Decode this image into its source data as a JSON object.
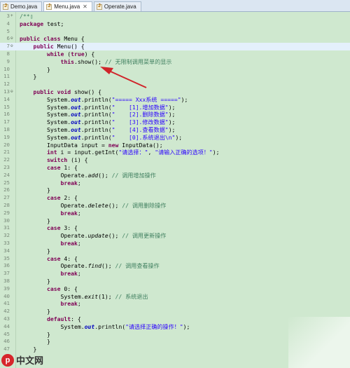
{
  "tabs": [
    {
      "label": "Demo.java",
      "active": false
    },
    {
      "label": "Menu.java",
      "active": true,
      "close": "✕"
    },
    {
      "label": "Operate.java",
      "active": false
    }
  ],
  "watermark": {
    "text": "中文网",
    "logo_char": "p"
  },
  "code_lines": [
    {
      "num": "3",
      "fold": "+",
      "segs": [
        {
          "t": "/**",
          "c": "cmt"
        },
        {
          "t": "▯",
          "c": "cmt"
        }
      ]
    },
    {
      "num": "4",
      "segs": [
        {
          "t": "package",
          "c": "kw"
        },
        {
          "t": " test;",
          "c": ""
        }
      ]
    },
    {
      "num": "5",
      "segs": []
    },
    {
      "num": "6",
      "fold": "⊖",
      "segs": [
        {
          "t": "public",
          "c": "kw"
        },
        {
          "t": " ",
          "c": ""
        },
        {
          "t": "class",
          "c": "kw"
        },
        {
          "t": " Menu {",
          "c": ""
        }
      ]
    },
    {
      "num": "7",
      "fold": "⊖",
      "hl": true,
      "segs": [
        {
          "t": "    ",
          "c": ""
        },
        {
          "t": "public",
          "c": "kw"
        },
        {
          "t": " Menu() {",
          "c": ""
        }
      ]
    },
    {
      "num": "8",
      "segs": [
        {
          "t": "        ",
          "c": ""
        },
        {
          "t": "while",
          "c": "kw"
        },
        {
          "t": " (",
          "c": ""
        },
        {
          "t": "true",
          "c": "kw"
        },
        {
          "t": ") {",
          "c": ""
        }
      ]
    },
    {
      "num": "9",
      "segs": [
        {
          "t": "            ",
          "c": ""
        },
        {
          "t": "this",
          "c": "kw"
        },
        {
          "t": ".show(); ",
          "c": ""
        },
        {
          "t": "// 无限制调用菜单的显示",
          "c": "cmt"
        }
      ]
    },
    {
      "num": "10",
      "segs": [
        {
          "t": "        }",
          "c": ""
        }
      ]
    },
    {
      "num": "11",
      "segs": [
        {
          "t": "    }",
          "c": ""
        }
      ]
    },
    {
      "num": "12",
      "segs": []
    },
    {
      "num": "13",
      "fold": "⊖",
      "segs": [
        {
          "t": "    ",
          "c": ""
        },
        {
          "t": "public",
          "c": "kw"
        },
        {
          "t": " ",
          "c": ""
        },
        {
          "t": "void",
          "c": "kw"
        },
        {
          "t": " show() {",
          "c": ""
        }
      ]
    },
    {
      "num": "14",
      "segs": [
        {
          "t": "        System.",
          "c": ""
        },
        {
          "t": "out",
          "c": "fld"
        },
        {
          "t": ".println(",
          "c": ""
        },
        {
          "t": "\"===== Xxx系统 =====\"",
          "c": "str"
        },
        {
          "t": ");",
          "c": ""
        }
      ]
    },
    {
      "num": "15",
      "segs": [
        {
          "t": "        System.",
          "c": ""
        },
        {
          "t": "out",
          "c": "fld"
        },
        {
          "t": ".println(",
          "c": ""
        },
        {
          "t": "\"    [1].增加数据\"",
          "c": "str"
        },
        {
          "t": ");",
          "c": ""
        }
      ]
    },
    {
      "num": "16",
      "segs": [
        {
          "t": "        System.",
          "c": ""
        },
        {
          "t": "out",
          "c": "fld"
        },
        {
          "t": ".println(",
          "c": ""
        },
        {
          "t": "\"    [2].删除数据\"",
          "c": "str"
        },
        {
          "t": ");",
          "c": ""
        }
      ]
    },
    {
      "num": "17",
      "segs": [
        {
          "t": "        System.",
          "c": ""
        },
        {
          "t": "out",
          "c": "fld"
        },
        {
          "t": ".println(",
          "c": ""
        },
        {
          "t": "\"    [3].修改数据\"",
          "c": "str"
        },
        {
          "t": ");",
          "c": ""
        }
      ]
    },
    {
      "num": "18",
      "segs": [
        {
          "t": "        System.",
          "c": ""
        },
        {
          "t": "out",
          "c": "fld"
        },
        {
          "t": ".println(",
          "c": ""
        },
        {
          "t": "\"    [4].查看数据\"",
          "c": "str"
        },
        {
          "t": ");",
          "c": ""
        }
      ]
    },
    {
      "num": "19",
      "segs": [
        {
          "t": "        System.",
          "c": ""
        },
        {
          "t": "out",
          "c": "fld"
        },
        {
          "t": ".println(",
          "c": ""
        },
        {
          "t": "\"    [0].系统退出\\n\"",
          "c": "str"
        },
        {
          "t": ");",
          "c": ""
        }
      ]
    },
    {
      "num": "20",
      "segs": [
        {
          "t": "        InputData input = ",
          "c": ""
        },
        {
          "t": "new",
          "c": "kw"
        },
        {
          "t": " InputData();",
          "c": ""
        }
      ]
    },
    {
      "num": "21",
      "segs": [
        {
          "t": "        ",
          "c": ""
        },
        {
          "t": "int",
          "c": "kw"
        },
        {
          "t": " i = input.getInt(",
          "c": ""
        },
        {
          "t": "\"请选择：\"",
          "c": "str"
        },
        {
          "t": ", ",
          "c": ""
        },
        {
          "t": "\"请输入正确的选项！\"",
          "c": "str"
        },
        {
          "t": ");",
          "c": ""
        }
      ]
    },
    {
      "num": "22",
      "segs": [
        {
          "t": "        ",
          "c": ""
        },
        {
          "t": "switch",
          "c": "kw"
        },
        {
          "t": " (i) {",
          "c": ""
        }
      ]
    },
    {
      "num": "23",
      "segs": [
        {
          "t": "        ",
          "c": ""
        },
        {
          "t": "case",
          "c": "kw"
        },
        {
          "t": " 1: {",
          "c": ""
        }
      ]
    },
    {
      "num": "24",
      "segs": [
        {
          "t": "            Operate.",
          "c": ""
        },
        {
          "t": "add",
          "c": "mth"
        },
        {
          "t": "(); ",
          "c": ""
        },
        {
          "t": "// 调用增加操作",
          "c": "cmt"
        }
      ]
    },
    {
      "num": "25",
      "segs": [
        {
          "t": "            ",
          "c": ""
        },
        {
          "t": "break",
          "c": "kw"
        },
        {
          "t": ";",
          "c": ""
        }
      ]
    },
    {
      "num": "26",
      "segs": [
        {
          "t": "        }",
          "c": ""
        }
      ]
    },
    {
      "num": "27",
      "segs": [
        {
          "t": "        ",
          "c": ""
        },
        {
          "t": "case",
          "c": "kw"
        },
        {
          "t": " 2: {",
          "c": ""
        }
      ]
    },
    {
      "num": "28",
      "segs": [
        {
          "t": "            Operate.",
          "c": ""
        },
        {
          "t": "delete",
          "c": "mth"
        },
        {
          "t": "(); ",
          "c": ""
        },
        {
          "t": "// 调用删除操作",
          "c": "cmt"
        }
      ]
    },
    {
      "num": "29",
      "segs": [
        {
          "t": "            ",
          "c": ""
        },
        {
          "t": "break",
          "c": "kw"
        },
        {
          "t": ";",
          "c": ""
        }
      ]
    },
    {
      "num": "30",
      "segs": [
        {
          "t": "        }",
          "c": ""
        }
      ]
    },
    {
      "num": "31",
      "segs": [
        {
          "t": "        ",
          "c": ""
        },
        {
          "t": "case",
          "c": "kw"
        },
        {
          "t": " 3: {",
          "c": ""
        }
      ]
    },
    {
      "num": "32",
      "segs": [
        {
          "t": "            Operate.",
          "c": ""
        },
        {
          "t": "update",
          "c": "mth"
        },
        {
          "t": "(); ",
          "c": ""
        },
        {
          "t": "// 调用更新操作",
          "c": "cmt"
        }
      ]
    },
    {
      "num": "33",
      "segs": [
        {
          "t": "            ",
          "c": ""
        },
        {
          "t": "break",
          "c": "kw"
        },
        {
          "t": ";",
          "c": ""
        }
      ]
    },
    {
      "num": "34",
      "segs": [
        {
          "t": "        }",
          "c": ""
        }
      ]
    },
    {
      "num": "35",
      "segs": [
        {
          "t": "        ",
          "c": ""
        },
        {
          "t": "case",
          "c": "kw"
        },
        {
          "t": " 4: {",
          "c": ""
        }
      ]
    },
    {
      "num": "36",
      "segs": [
        {
          "t": "            Operate.",
          "c": ""
        },
        {
          "t": "find",
          "c": "mth"
        },
        {
          "t": "(); ",
          "c": ""
        },
        {
          "t": "// 调用查看操作",
          "c": "cmt"
        }
      ]
    },
    {
      "num": "37",
      "segs": [
        {
          "t": "            ",
          "c": ""
        },
        {
          "t": "break",
          "c": "kw"
        },
        {
          "t": ";",
          "c": ""
        }
      ]
    },
    {
      "num": "38",
      "segs": [
        {
          "t": "        }",
          "c": ""
        }
      ]
    },
    {
      "num": "39",
      "segs": [
        {
          "t": "        ",
          "c": ""
        },
        {
          "t": "case",
          "c": "kw"
        },
        {
          "t": " 0: {",
          "c": ""
        }
      ]
    },
    {
      "num": "40",
      "segs": [
        {
          "t": "            System.",
          "c": ""
        },
        {
          "t": "exit",
          "c": "mth"
        },
        {
          "t": "(1); ",
          "c": ""
        },
        {
          "t": "// 系统退出",
          "c": "cmt"
        }
      ]
    },
    {
      "num": "41",
      "segs": [
        {
          "t": "            ",
          "c": ""
        },
        {
          "t": "break",
          "c": "kw"
        },
        {
          "t": ";",
          "c": ""
        }
      ]
    },
    {
      "num": "42",
      "segs": [
        {
          "t": "        }",
          "c": ""
        }
      ]
    },
    {
      "num": "43",
      "segs": [
        {
          "t": "        ",
          "c": ""
        },
        {
          "t": "default",
          "c": "kw"
        },
        {
          "t": ": {",
          "c": ""
        }
      ]
    },
    {
      "num": "44",
      "segs": [
        {
          "t": "            System.",
          "c": ""
        },
        {
          "t": "out",
          "c": "fld"
        },
        {
          "t": ".println(",
          "c": ""
        },
        {
          "t": "\"请选择正确的操作！\"",
          "c": "str"
        },
        {
          "t": ");",
          "c": ""
        }
      ]
    },
    {
      "num": "45",
      "segs": [
        {
          "t": "        }",
          "c": ""
        }
      ]
    },
    {
      "num": "46",
      "segs": [
        {
          "t": "        }",
          "c": ""
        }
      ]
    },
    {
      "num": "47",
      "segs": [
        {
          "t": "    }",
          "c": ""
        }
      ]
    },
    {
      "num": "48",
      "segs": []
    }
  ]
}
